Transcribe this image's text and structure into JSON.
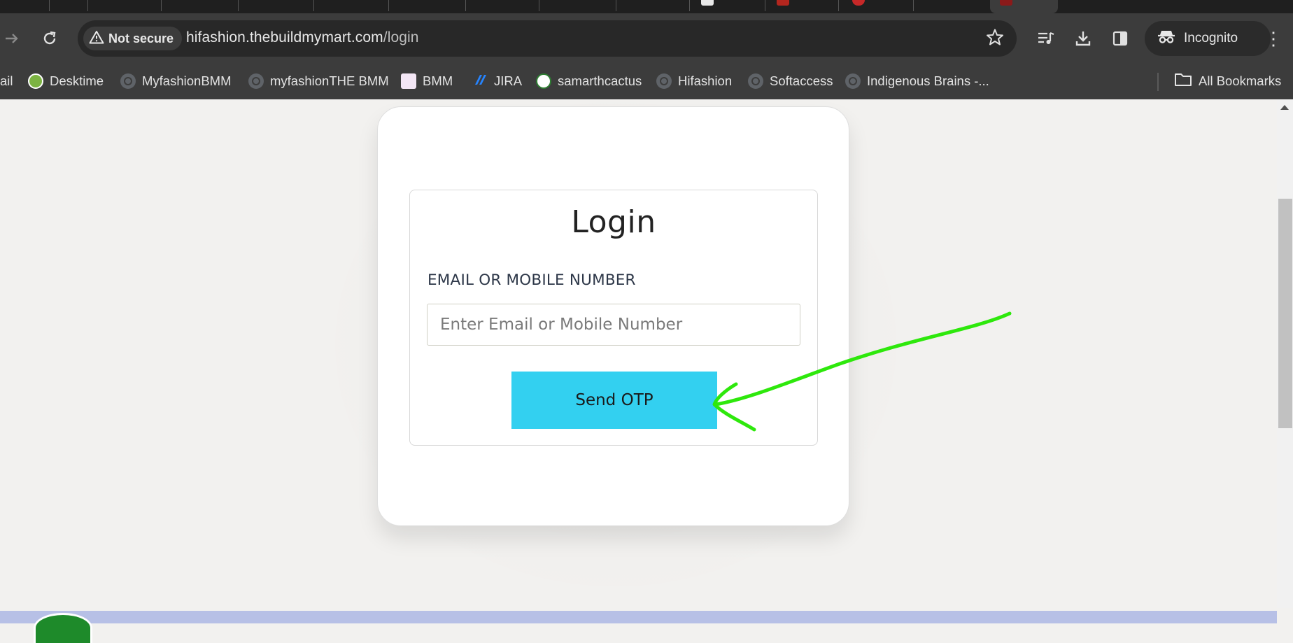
{
  "browser": {
    "security_label": "Not secure",
    "url_host": "hifashion.thebuildmymart.com",
    "url_path": "/login",
    "profile_label": "Incognito"
  },
  "bookmarks": [
    {
      "label": "ail"
    },
    {
      "label": "Desktime"
    },
    {
      "label": "MyfashionBMM"
    },
    {
      "label": "myfashionTHE BMM"
    },
    {
      "label": "BMM"
    },
    {
      "label": "JIRA"
    },
    {
      "label": "samarthcactus"
    },
    {
      "label": "Hifashion"
    },
    {
      "label": "Softaccess"
    },
    {
      "label": "Indigenous Brains -..."
    }
  ],
  "all_bookmarks_label": "All Bookmarks",
  "login": {
    "title": "Login",
    "field_label": "EMAIL OR MOBILE NUMBER",
    "field_placeholder": "Enter Email or Mobile Number",
    "field_value": "",
    "submit_label": "Send OTP"
  },
  "colors": {
    "button": "#33d0f0",
    "annotation_arrow": "#2ee80c",
    "footer": "#b7c0e6"
  }
}
